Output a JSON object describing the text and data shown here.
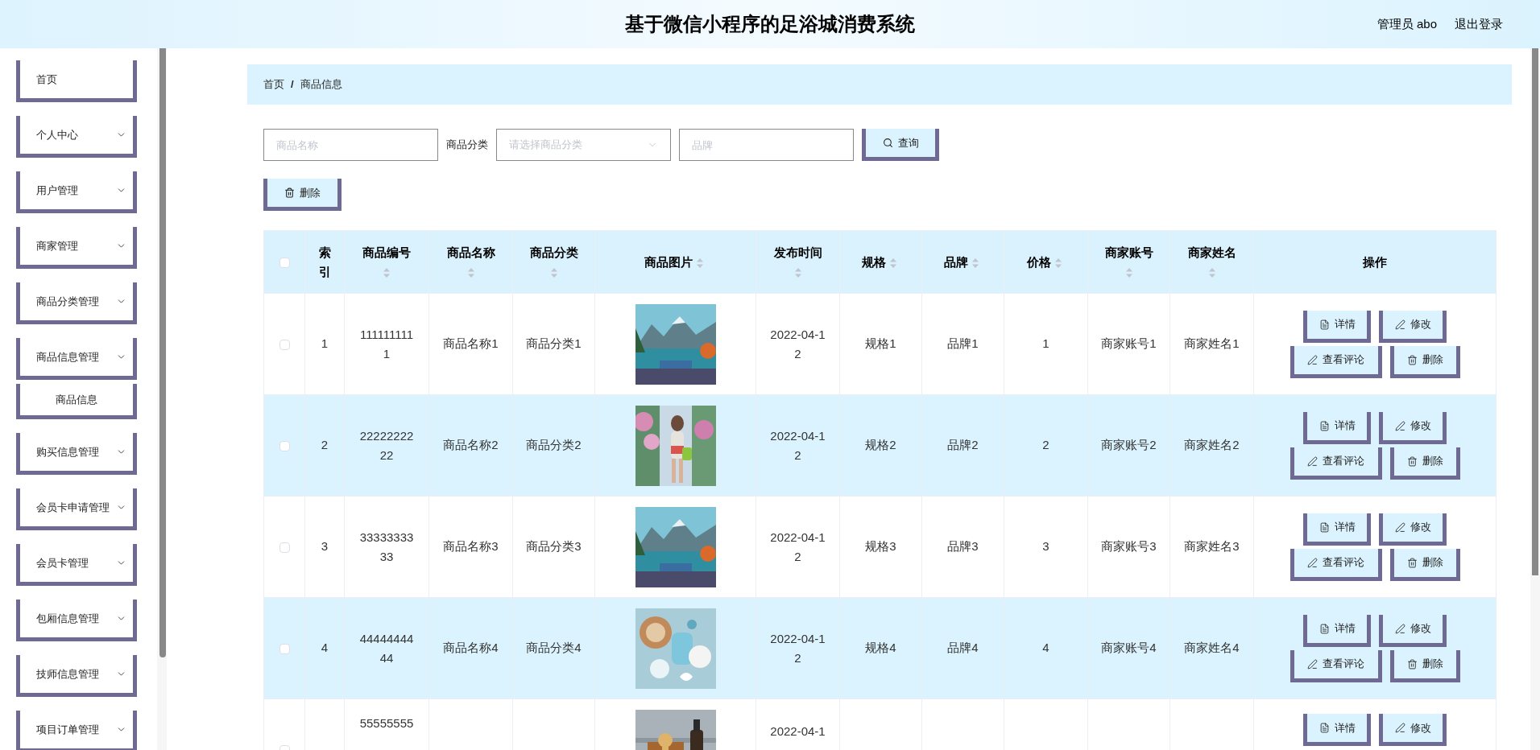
{
  "header": {
    "title": "基于微信小程序的足浴城消费系统",
    "user": "管理员 abo",
    "logout": "退出登录"
  },
  "sidebar": {
    "items": [
      {
        "label": "首页",
        "expandable": false
      },
      {
        "label": "个人中心",
        "expandable": true
      },
      {
        "label": "用户管理",
        "expandable": true
      },
      {
        "label": "商家管理",
        "expandable": true
      },
      {
        "label": "商品分类管理",
        "expandable": true
      },
      {
        "label": "商品信息管理",
        "expandable": true,
        "children": [
          {
            "label": "商品信息"
          }
        ]
      },
      {
        "label": "购买信息管理",
        "expandable": true
      },
      {
        "label": "会员卡申请管理",
        "expandable": true
      },
      {
        "label": "会员卡管理",
        "expandable": true
      },
      {
        "label": "包厢信息管理",
        "expandable": true
      },
      {
        "label": "技师信息管理",
        "expandable": true
      },
      {
        "label": "项目订单管理",
        "expandable": true
      }
    ]
  },
  "breadcrumb": {
    "items": [
      "首页",
      "商品信息"
    ],
    "separator": "/"
  },
  "search": {
    "name_field": {
      "placeholder": "商品名称"
    },
    "category_label": "商品分类",
    "category_select": {
      "placeholder": "请选择商品分类"
    },
    "brand_field": {
      "placeholder": "品牌"
    },
    "button": "查询"
  },
  "toolbar": {
    "delete_button": "删除"
  },
  "table": {
    "header_checkbox": {
      "checked": false
    },
    "columns": [
      {
        "label": "索引",
        "sortable": false
      },
      {
        "label": "商品编号",
        "sortable": true
      },
      {
        "label": "商品名称",
        "sortable": true
      },
      {
        "label": "商品分类",
        "sortable": true
      },
      {
        "label": "商品图片",
        "sortable": true
      },
      {
        "label": "发布时间",
        "sortable": true
      },
      {
        "label": "规格",
        "sortable": true
      },
      {
        "label": "品牌",
        "sortable": true
      },
      {
        "label": "价格",
        "sortable": true
      },
      {
        "label": "商家账号",
        "sortable": true
      },
      {
        "label": "商家姓名",
        "sortable": true
      },
      {
        "label": "操作",
        "sortable": false
      }
    ],
    "rows": [
      {
        "checked": false,
        "index": "1",
        "code": "1111111111",
        "name": "商品名称1",
        "category": "商品分类1",
        "picture": {
          "kind": "picture"
        },
        "date": "2022-04-12",
        "spec": "规格1",
        "brand": "品牌1",
        "price": "1",
        "merchant_account": "商家账号1",
        "merchant_name": "商家姓名1",
        "actions": [
          {
            "kind": "detail",
            "label": "详情"
          },
          {
            "kind": "edit",
            "label": "修改"
          },
          {
            "kind": "review",
            "label": "查看评论"
          },
          {
            "kind": "delete",
            "label": "删除"
          }
        ]
      },
      {
        "checked": false,
        "index": "2",
        "code": "2222222222",
        "name": "商品名称2",
        "category": "商品分类2",
        "picture": {
          "kind": "picture"
        },
        "date": "2022-04-12",
        "spec": "规格2",
        "brand": "品牌2",
        "price": "2",
        "merchant_account": "商家账号2",
        "merchant_name": "商家姓名2",
        "actions": [
          {
            "kind": "detail",
            "label": "详情"
          },
          {
            "kind": "edit",
            "label": "修改"
          },
          {
            "kind": "review",
            "label": "查看评论"
          },
          {
            "kind": "delete",
            "label": "删除"
          }
        ]
      },
      {
        "checked": false,
        "index": "3",
        "code": "3333333333",
        "name": "商品名称3",
        "category": "商品分类3",
        "picture": {
          "kind": "picture"
        },
        "date": "2022-04-12",
        "spec": "规格3",
        "brand": "品牌3",
        "price": "3",
        "merchant_account": "商家账号3",
        "merchant_name": "商家姓名3",
        "actions": [
          {
            "kind": "detail",
            "label": "详情"
          },
          {
            "kind": "edit",
            "label": "修改"
          },
          {
            "kind": "review",
            "label": "查看评论"
          },
          {
            "kind": "delete",
            "label": "删除"
          }
        ]
      },
      {
        "checked": false,
        "index": "4",
        "code": "4444444444",
        "name": "商品名称4",
        "category": "商品分类4",
        "picture": {
          "kind": "picture"
        },
        "date": "2022-04-12",
        "spec": "规格4",
        "brand": "品牌4",
        "price": "4",
        "merchant_account": "商家账号4",
        "merchant_name": "商家姓名4",
        "actions": [
          {
            "kind": "detail",
            "label": "详情"
          },
          {
            "kind": "edit",
            "label": "修改"
          },
          {
            "kind": "review",
            "label": "查看评论"
          },
          {
            "kind": "delete",
            "label": "删除"
          }
        ]
      },
      {
        "checked": false,
        "code": "55555555",
        "picture": {
          "kind": "picture"
        },
        "date": "2022-04-1",
        "actions": [
          {
            "kind": "detail",
            "label": "详情"
          },
          {
            "kind": "edit",
            "label": "修改"
          }
        ]
      }
    ]
  }
}
